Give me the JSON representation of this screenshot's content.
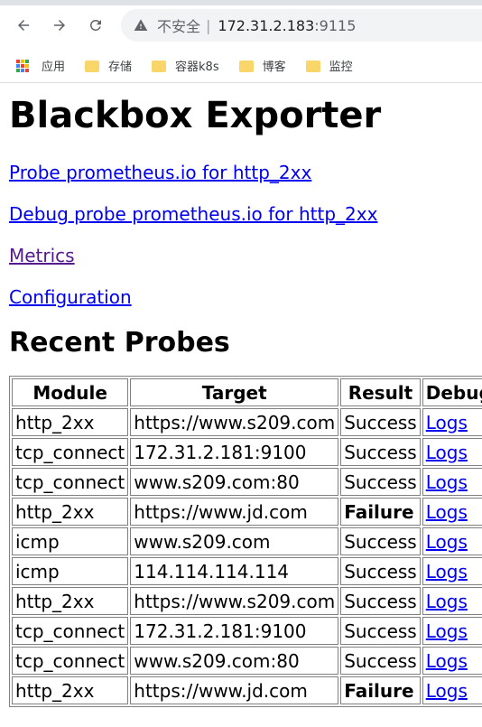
{
  "browser": {
    "address_warning": "不安全",
    "host": "172.31.2.183",
    "port": ":9115",
    "bookmarks": [
      {
        "label": "应用"
      },
      {
        "label": "存储"
      },
      {
        "label": "容器k8s"
      },
      {
        "label": "博客"
      },
      {
        "label": "监控"
      }
    ]
  },
  "page": {
    "title": "Blackbox Exporter",
    "links": {
      "probe": "Probe prometheus.io for http_2xx",
      "debug": "Debug probe prometheus.io for http_2xx",
      "metrics": "Metrics",
      "configuration": "Configuration"
    },
    "recent_title": "Recent Probes",
    "table": {
      "headers": [
        "Module",
        "Target",
        "Result",
        "Debug"
      ],
      "rows": [
        [
          "http_2xx",
          "https://www.s209.com",
          "Success",
          "Logs"
        ],
        [
          "tcp_connect",
          "172.31.2.181:9100",
          "Success",
          "Logs"
        ],
        [
          "tcp_connect",
          "www.s209.com:80",
          "Success",
          "Logs"
        ],
        [
          "http_2xx",
          "https://www.jd.com",
          "Failure",
          "Logs"
        ],
        [
          "icmp",
          "www.s209.com",
          "Success",
          "Logs"
        ],
        [
          "icmp",
          "114.114.114.114",
          "Success",
          "Logs"
        ],
        [
          "http_2xx",
          "https://www.s209.com",
          "Success",
          "Logs"
        ],
        [
          "tcp_connect",
          "172.31.2.181:9100",
          "Success",
          "Logs"
        ],
        [
          "tcp_connect",
          "www.s209.com:80",
          "Success",
          "Logs"
        ],
        [
          "http_2xx",
          "https://www.jd.com",
          "Failure",
          "Logs"
        ]
      ]
    }
  }
}
